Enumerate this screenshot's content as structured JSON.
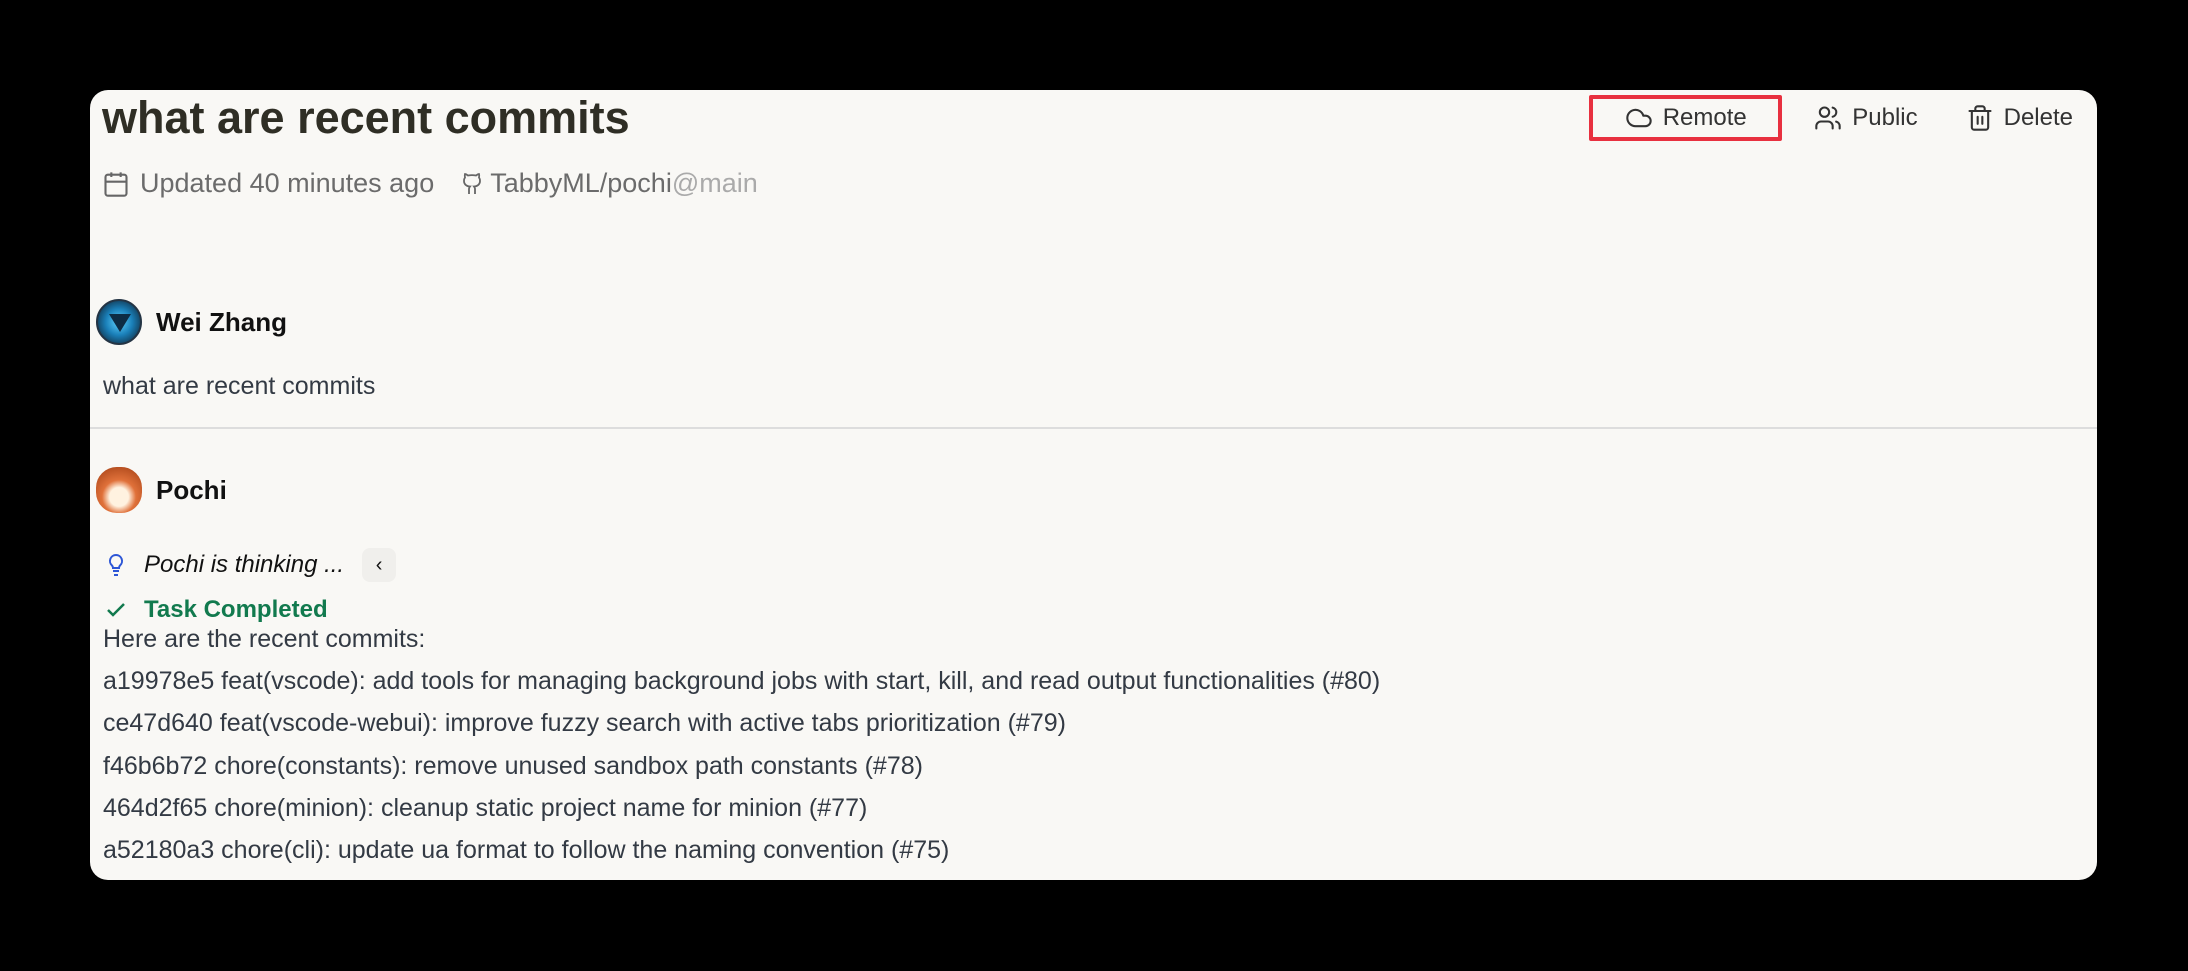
{
  "header": {
    "title": "what are recent commits",
    "actions": [
      {
        "label": "Remote",
        "icon": "cloud-icon",
        "highlighted": true
      },
      {
        "label": "Public",
        "icon": "users-icon"
      },
      {
        "label": "Delete",
        "icon": "trash-icon"
      }
    ],
    "updated": "Updated 40 minutes ago",
    "repo": "TabbyML/pochi",
    "branch": "@main"
  },
  "messages": {
    "user": {
      "name": "Wei Zhang",
      "text": "what are recent commits"
    },
    "assistant": {
      "name": "Pochi",
      "thinking": "Pochi is thinking ...",
      "status": "Task Completed",
      "intro": "Here are the recent commits:",
      "commits": [
        "a19978e5 feat(vscode): add tools for managing background jobs with start, kill, and read output functionalities (#80)",
        "ce47d640 feat(vscode-webui): improve fuzzy search with active tabs prioritization (#79)",
        "f46b6b72 chore(constants): remove unused sandbox path constants (#78)",
        "464d2f65 chore(minion): cleanup static project name for minion (#77)",
        "a52180a3 chore(cli): update ua format to follow the naming convention (#75)"
      ]
    }
  },
  "colors": {
    "highlight": "#e8303f",
    "success": "#127a4e",
    "accent": "#2d56d6"
  }
}
